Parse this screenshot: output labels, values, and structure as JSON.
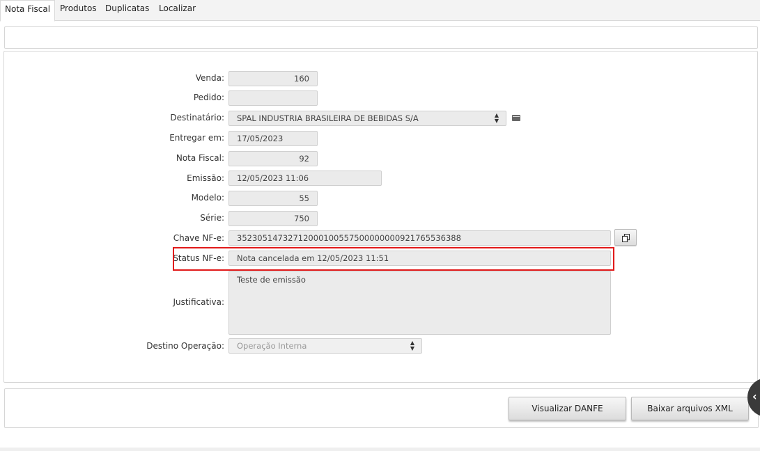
{
  "tabs": [
    "Nota Fiscal",
    "Produtos",
    "Duplicatas",
    "Localizar"
  ],
  "form": {
    "venda": {
      "label": "Venda:",
      "value": "160"
    },
    "pedido": {
      "label": "Pedido:",
      "value": ""
    },
    "destinatario": {
      "label": "Destinatário:",
      "value": "SPAL INDUSTRIA BRASILEIRA DE BEBIDAS S/A"
    },
    "entregar_em": {
      "label": "Entregar em:",
      "value": "17/05/2023"
    },
    "nota_fiscal": {
      "label": "Nota Fiscal:",
      "value": "92"
    },
    "emissao": {
      "label": "Emissão:",
      "value": "12/05/2023 11:06"
    },
    "modelo": {
      "label": "Modelo:",
      "value": "55"
    },
    "serie": {
      "label": "Série:",
      "value": "750"
    },
    "chave_nfe": {
      "label": "Chave NF-e:",
      "value": "35230514732712000100557500000000921765536388"
    },
    "status_nfe": {
      "label": "Status NF-e:",
      "value": "Nota cancelada em 12/05/2023 11:51"
    },
    "justificativa": {
      "label": "Justificativa:",
      "value": "Teste de emissão"
    },
    "destino_operacao": {
      "label": "Destino Operação:",
      "value": "Operação Interna"
    }
  },
  "buttons": {
    "visualizar_danfe": "Visualizar DANFE",
    "baixar_xml": "Baixar arquivos XML"
  },
  "icons": {
    "destinatario_action": "card-icon",
    "copy": "copy-icon",
    "side_toggle": "chevron-left-icon"
  },
  "colors": {
    "highlight": "#e11919",
    "field_bg": "#ebebeb"
  }
}
